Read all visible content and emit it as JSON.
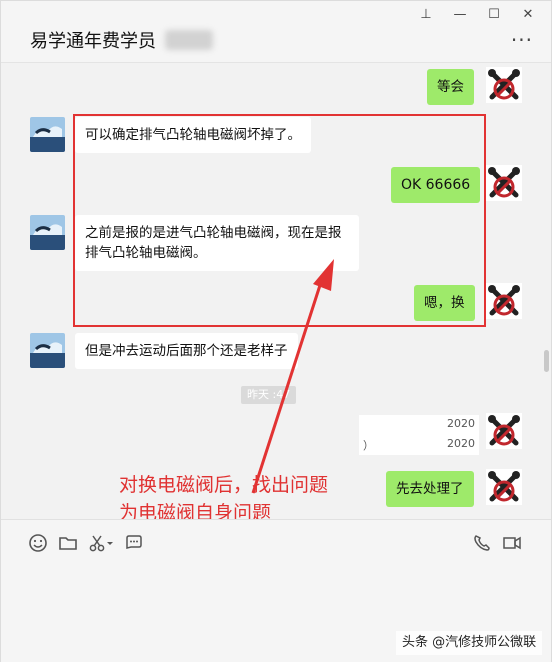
{
  "window": {
    "title": "易学通年费学员",
    "controls": {
      "pin": "⊥",
      "minimize": "—",
      "maximize": "☐",
      "close": "✕"
    },
    "more": "···"
  },
  "messages": [
    {
      "side": "out",
      "text": "等会"
    },
    {
      "side": "in",
      "text": "可以确定排气凸轮轴电磁阀坏掉了。"
    },
    {
      "side": "out",
      "text": "OK 66666"
    },
    {
      "side": "in",
      "text_line1": "之前是报的是进气凸轮轴电磁阀，现在是报",
      "text_line2": "排气凸轮轴电磁阀。"
    },
    {
      "side": "out",
      "text": "嗯，换"
    },
    {
      "side": "in",
      "text": "但是冲去运动后面那个还是老样子"
    }
  ],
  "time_separator": "昨天 :47",
  "file_cards": [
    {
      "text_right": "2020"
    },
    {
      "text_left": "）",
      "text_right": "2020"
    }
  ],
  "last_message": {
    "side": "out",
    "text": "先去处理了"
  },
  "annotation": {
    "line1": "对换电磁阀后，找出问题",
    "line2": "为电磁阀自身问题",
    "color": "#e03232"
  },
  "toolbar": {
    "icons": [
      "emoji-icon",
      "folder-icon",
      "scissors-icon",
      "chat-history-icon",
      "phone-icon",
      "video-icon"
    ]
  },
  "watermark": "头条 @汽修技师公微联",
  "colors": {
    "bubble_out": "#9eea6a",
    "bubble_in": "#ffffff",
    "accent_red": "#e23333"
  }
}
